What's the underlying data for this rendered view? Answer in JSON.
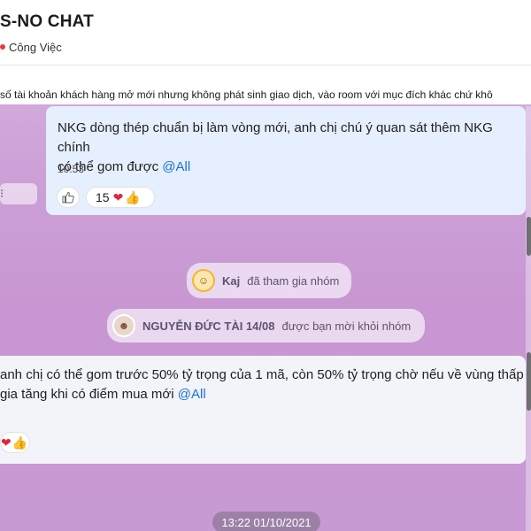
{
  "header": {
    "group_title": "S-NO CHAT",
    "tag_label": "Công Việc",
    "tag_color": "#e53b3b"
  },
  "pinned": {
    "text": "số tài khoản khách hàng mở mới nhưng không phát sinh giao dịch, vào room với mục đích khác chứ khô"
  },
  "messages": [
    {
      "line1": "NKG dòng thép chuẩn bị làm vòng mới, anh chị chú ý quan sát thêm NKG chính",
      "line2": "có thể gom được ",
      "mention": "@All",
      "time": "10:53",
      "reaction_count": "15",
      "reaction_icons": [
        "heart-icon",
        "thumbs-up-icon"
      ]
    },
    {
      "line1": "anh chị có thể gom trước 50% tỷ trọng của 1 mã, còn 50% tỷ trọng chờ nếu về vùng thấp",
      "line2": "gia tăng khi có điểm mua mới ",
      "mention": "@All",
      "reaction_icons": [
        "heart-icon",
        "thumbs-up-icon"
      ]
    }
  ],
  "system": [
    {
      "name": "Kaj",
      "text": "đã tham gia nhóm"
    },
    {
      "name": "NGUYỄN ĐỨC TÀI 14/08",
      "text": "được bạn mời khỏi nhóm"
    }
  ],
  "date_separator": "13:22 01/10/2021",
  "colors": {
    "bubble": "#e6effd",
    "mention": "#1b6fd6",
    "background": "#cc9fd6"
  }
}
